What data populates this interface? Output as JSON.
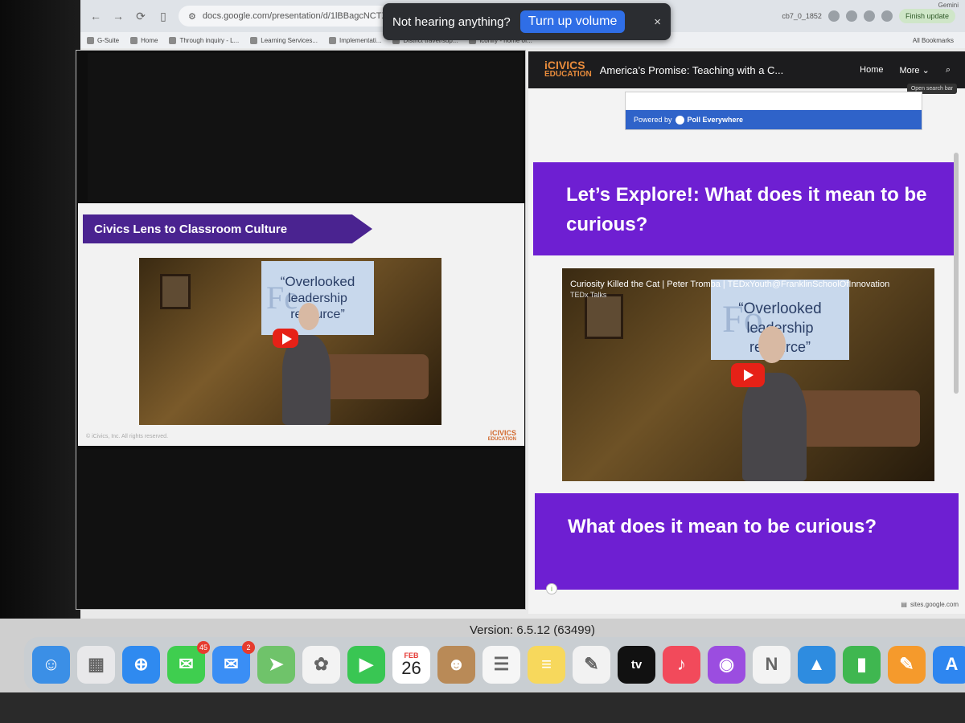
{
  "browser": {
    "url": "docs.google.com/presentation/d/1lBBagcNCTXRgyBsiDaqd",
    "url_tail": "cb7_0_1852",
    "finish_update_label": "Finish update",
    "gemini_label": "Gemini"
  },
  "bookmarks": [
    {
      "label": "G-Suite"
    },
    {
      "label": "Home"
    },
    {
      "label": "Through inquiry - L..."
    },
    {
      "label": "Learning Services..."
    },
    {
      "label": "Implementati..."
    },
    {
      "label": "District travel/sup..."
    },
    {
      "label": "iconify - home of..."
    }
  ],
  "bookmarks_all": "All Bookmarks",
  "toast": {
    "message": "Not hearing anything?",
    "button": "Turn up volume",
    "close": "×"
  },
  "slide": {
    "banner": "Civics Lens to Classroom Culture",
    "video_screen_line1": "“Overlooked",
    "video_screen_line2": "leadership",
    "video_screen_line3": "resource”",
    "copyright": "© iCivics, Inc. All rights reserved.",
    "logo_top": "iCIVICS",
    "logo_bottom": "EDUCATION"
  },
  "site": {
    "logo_top": "iCIVICS",
    "logo_bottom": "EDUCATION",
    "title": "America’s Promise: Teaching with a C...",
    "nav_home": "Home",
    "nav_more": "More",
    "search_tooltip": "Open search bar",
    "poll_powered": "Powered by",
    "poll_brand": "Poll Everywhere",
    "heading1": "Let’s Explore!: What does it mean to be curious?",
    "video_title": "Curiosity Killed the Cat | Peter Tromba | TEDxYouth@FranklinSchoolOfInnovation",
    "video_channel": "TEDx Talks",
    "video_screen_line1": "“Overlooked",
    "video_screen_line2": "leadership",
    "video_screen_line3": "resource”",
    "heading2": "What does it mean to be curious?",
    "footer_host": "sites.google.com"
  },
  "version_text": "Version: 6.5.12 (63499)",
  "dock": [
    {
      "name": "finder",
      "color": "#3b8fe6",
      "glyph": "☺"
    },
    {
      "name": "launchpad",
      "color": "#e8e8ea",
      "glyph": "▦"
    },
    {
      "name": "safari",
      "color": "#2f8af0",
      "glyph": "⊕"
    },
    {
      "name": "messages",
      "color": "#3fce4f",
      "glyph": "✉",
      "badge": "45"
    },
    {
      "name": "mail",
      "color": "#3a8ef5",
      "glyph": "✉",
      "badge": "2"
    },
    {
      "name": "maps",
      "color": "#6fc36a",
      "glyph": "➤"
    },
    {
      "name": "photos",
      "color": "#f3f3f3",
      "glyph": "✿"
    },
    {
      "name": "facetime",
      "color": "#39c653",
      "glyph": "▶"
    },
    {
      "name": "calendar",
      "color": "#ffffff",
      "month": "FEB",
      "day": "26"
    },
    {
      "name": "contacts",
      "color": "#b98a57",
      "glyph": "☻"
    },
    {
      "name": "reminders",
      "color": "#f6f6f6",
      "glyph": "☰"
    },
    {
      "name": "notes",
      "color": "#f7d85c",
      "glyph": "≡"
    },
    {
      "name": "freeform",
      "color": "#f2f2f2",
      "glyph": "✎"
    },
    {
      "name": "tv",
      "color": "#111111",
      "glyph": "tv"
    },
    {
      "name": "music",
      "color": "#f24a5b",
      "glyph": "♪"
    },
    {
      "name": "podcasts",
      "color": "#9b4de0",
      "glyph": "◉"
    },
    {
      "name": "news",
      "color": "#f3f3f3",
      "glyph": "N"
    },
    {
      "name": "keynote",
      "color": "#2e8ce0",
      "glyph": "▲"
    },
    {
      "name": "numbers",
      "color": "#3fb750",
      "glyph": "▮"
    },
    {
      "name": "pages",
      "color": "#f59a2c",
      "glyph": "✎"
    },
    {
      "name": "app-store",
      "color": "#2e86f0",
      "glyph": "A"
    }
  ]
}
